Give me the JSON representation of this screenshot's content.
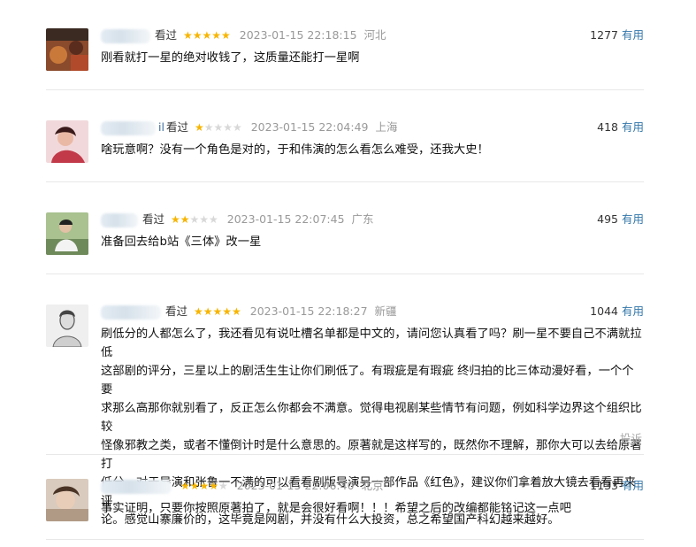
{
  "comments": [
    {
      "user": "",
      "seen": "看过",
      "rating": 5,
      "time": "2023-01-15 22:18:15",
      "location": "河北",
      "useful_count": "1277",
      "useful_label": "有用",
      "text": "刚看就打一星的绝对收钱了，这质量还能打一星啊",
      "avatar_color": "#8a4a2c"
    },
    {
      "user": "il",
      "seen": "看过",
      "rating": 1,
      "time": "2023-01-15 22:04:49",
      "location": "上海",
      "useful_count": "418",
      "useful_label": "有用",
      "text": "啥玩意啊？没有一个角色是对的，于和伟演的怎么看怎么难受，还我大史！",
      "avatar_color": "#c23a4a"
    },
    {
      "user": "",
      "seen": "看过",
      "rating": 2,
      "time": "2023-01-15 22:07:45",
      "location": "广东",
      "useful_count": "495",
      "useful_label": "有用",
      "text": "准备回去给b站《三体》改一星",
      "avatar_color": "#6f8a5a"
    },
    {
      "user": "",
      "seen": "看过",
      "rating": 5,
      "time": "2023-01-15 22:18:27",
      "location": "新疆",
      "useful_count": "1044",
      "useful_label": "有用",
      "text_lines": [
        "刷低分的人都怎么了，我还看见有说吐槽名单都是中文的，请问您认真看了吗？刷一星不要自己不满就拉低",
        "这部剧的评分，三星以上的剧活生生让你们刷低了。有瑕疵是有瑕疵 终归拍的比三体动漫好看，一个个要",
        "求那么高那你就别看了，反正怎么你都会不满意。觉得电视剧某些情节有问题，例如科学边界这个组织比较",
        "怪像邪教之类，或者不懂倒计时是什么意思的。原著就是这样写的，既然你不理解，那你大可以去给原著打",
        "低分。对于导演和张鲁一不满的可以看看剧版导演另一部作品《红色》，建议你们拿着放大镜去看看再来评",
        "论。感觉山寨廉价的，这毕竟是网剧，并没有什么大投资，总之希望国产科幻越来越好。"
      ],
      "report_label": "投诉",
      "avatar_color": "#d9d9d9"
    },
    {
      "user": "",
      "seen": "",
      "rating": 4,
      "time": "2023-01-15 22:06:40",
      "location": "北京",
      "useful_count": "1133",
      "useful_label": "有用",
      "text": "事实证明，只要你按照原著拍了，就是会很好看啊！！！希望之后的改编都能铭记这一点吧",
      "avatar_color": "#b09a86"
    }
  ]
}
